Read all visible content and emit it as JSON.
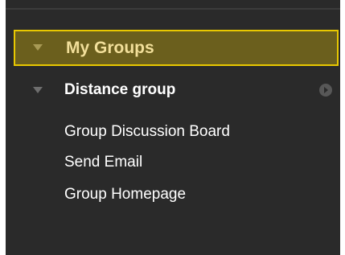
{
  "my_groups": {
    "header_label": "My Groups",
    "groups": [
      {
        "name": "Distance group",
        "links": [
          "Group Discussion Board",
          "Send Email",
          "Group Homepage"
        ]
      }
    ]
  },
  "colors": {
    "panel_bg": "#2a2a2a",
    "header_bg": "#6b5f1d",
    "header_border": "#e8c800",
    "header_text": "#f2df9a",
    "text": "#ffffff"
  },
  "icons": {
    "header_toggle": "caret-down-icon",
    "group_toggle": "caret-down-icon",
    "group_go": "arrow-right-circle-icon"
  }
}
